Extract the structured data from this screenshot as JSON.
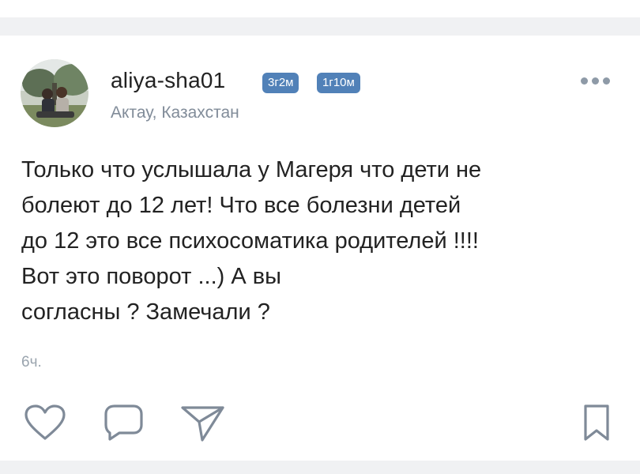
{
  "post": {
    "username": "aliya-sha01",
    "badges": [
      "3г2м",
      "1г10м"
    ],
    "location": "Актау, Казахстан",
    "text_lines": [
      "Только что услышала у Магеря что дети не",
      "болеют до 12 лет! Что все болезни детей",
      "до 12 это все психосоматика родителей !!!!",
      "Вот это поворот ...) А вы",
      "согласны ? Замечали ?"
    ],
    "time": "6ч."
  },
  "icons": {
    "menu": "more-dots-icon",
    "like": "heart-icon",
    "comment": "comment-bubble-icon",
    "share": "paper-plane-icon",
    "save": "bookmark-icon"
  },
  "colors": {
    "badge": "#5181b8",
    "text": "#222222",
    "secondary": "#818c99",
    "icon_stroke": "#7f8a98",
    "background": "#f0f1f3"
  }
}
